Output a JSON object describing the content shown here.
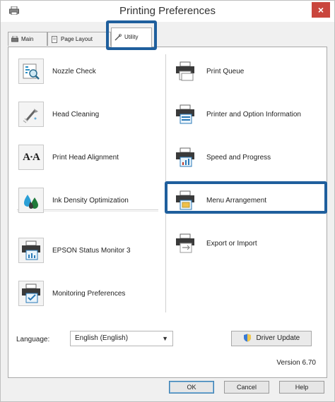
{
  "window": {
    "title": "Printing Preferences",
    "close_glyph": "×"
  },
  "tabs": [
    {
      "label": "Main",
      "icon": "printer-icon"
    },
    {
      "label": "Page Layout",
      "icon": "page-icon"
    },
    {
      "label": "Utility",
      "icon": "wrench-icon"
    }
  ],
  "left_items": [
    {
      "label": "Nozzle Check",
      "icon": "nozzle-check-icon"
    },
    {
      "label": "Head Cleaning",
      "icon": "head-cleaning-icon"
    },
    {
      "label": "Print Head Alignment",
      "icon": "alignment-icon",
      "icon_text": "A·A"
    },
    {
      "label": "Ink Density Optimization",
      "icon": "ink-drops-icon"
    },
    {
      "label": "EPSON Status Monitor 3",
      "icon": "status-monitor-icon"
    },
    {
      "label": "Monitoring Preferences",
      "icon": "monitoring-prefs-icon"
    }
  ],
  "right_items": [
    {
      "label": "Print Queue",
      "icon": "print-queue-icon"
    },
    {
      "label": "Printer and Option Information",
      "icon": "printer-info-icon"
    },
    {
      "label": "Speed and Progress",
      "icon": "speed-progress-icon"
    },
    {
      "label": "Menu Arrangement",
      "icon": "menu-arrangement-icon"
    },
    {
      "label": "Export or Import",
      "icon": "export-import-icon"
    }
  ],
  "language": {
    "label": "Language:",
    "value": "English (English)"
  },
  "driver_update": {
    "label": "Driver Update"
  },
  "version": "Version 6.70",
  "buttons": {
    "ok": "OK",
    "cancel": "Cancel",
    "help": "Help"
  },
  "colors": {
    "highlight": "#1f5f9d",
    "close": "#c9463d"
  }
}
